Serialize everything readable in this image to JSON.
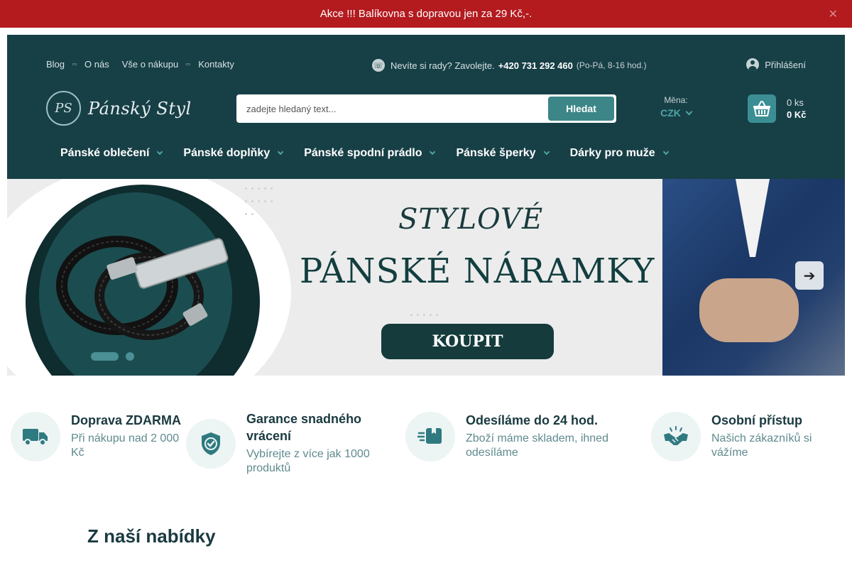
{
  "promo": {
    "text": "Akce !!! Balíkovna s dopravou jen za 29 Kč,-.",
    "close": "✕"
  },
  "header": {
    "links": [
      "Blog",
      "O nás",
      "Vše o nákupu",
      "Kontakty"
    ],
    "contact": {
      "text": "Nevíte si rady? Zavolejte.",
      "phone": "+420 731 292 460",
      "hours": "(Po-Pá, 8-16 hod.)"
    },
    "login": "Přihlášení",
    "logo": {
      "mark": "PS",
      "name": "Pánský Styl"
    },
    "search": {
      "placeholder": "zadejte hledaný text...",
      "button": "Hledat"
    },
    "currency": {
      "label": "Měna:",
      "value": "CZK"
    },
    "cart": {
      "count": "0 ks",
      "total": "0 Kč"
    }
  },
  "nav": [
    "Pánské oblečení",
    "Pánské doplňky",
    "Pánské spodní prádlo",
    "Pánské šperky",
    "Dárky pro muže"
  ],
  "banner": {
    "line1": "STYLOVÉ",
    "line2": "PÁNSKÉ NÁRAMKY",
    "cta": "KOUPIT",
    "next": "➔"
  },
  "features": [
    {
      "title": "Doprava ZDARMA",
      "desc": "Při nákupu nad 2 000 Kč",
      "icon": "truck-icon"
    },
    {
      "title": "Garance snadného vrácení",
      "desc": "Vybírejte z více jak 1000 produktů",
      "icon": "shield-check-icon"
    },
    {
      "title": "Odesíláme do 24 hod.",
      "desc": "Zboží máme skladem, ihned odesíláme",
      "icon": "fast-package-icon"
    },
    {
      "title": "Osobní přístup",
      "desc": "Našich zákazníků si vážíme",
      "icon": "handshake-icon"
    }
  ],
  "section": {
    "title": "Z naší nabídky"
  },
  "colors": {
    "promo": "#b31b1f",
    "header": "#173f46",
    "accent": "#3d8688"
  }
}
